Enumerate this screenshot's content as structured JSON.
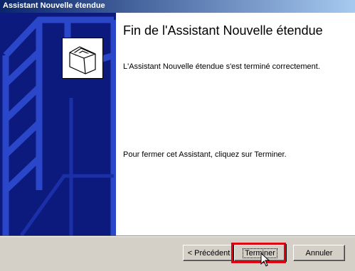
{
  "window": {
    "title": "Assistant Nouvelle étendue"
  },
  "wizard": {
    "heading": "Fin de l'Assistant Nouvelle étendue",
    "message": "L'Assistant Nouvelle étendue s'est terminé correctement.",
    "instruction": "Pour fermer cet Assistant, cliquez sur Terminer."
  },
  "buttons": {
    "back": "< Précédent",
    "finish": "Terminer",
    "cancel": "Annuler"
  },
  "colors": {
    "side_panel": "#0c1a7e",
    "title_start": "#0a246a",
    "highlight": "#e00010"
  },
  "icons": {
    "wizard": "folders-icon",
    "cursor": "mouse-pointer-icon"
  }
}
